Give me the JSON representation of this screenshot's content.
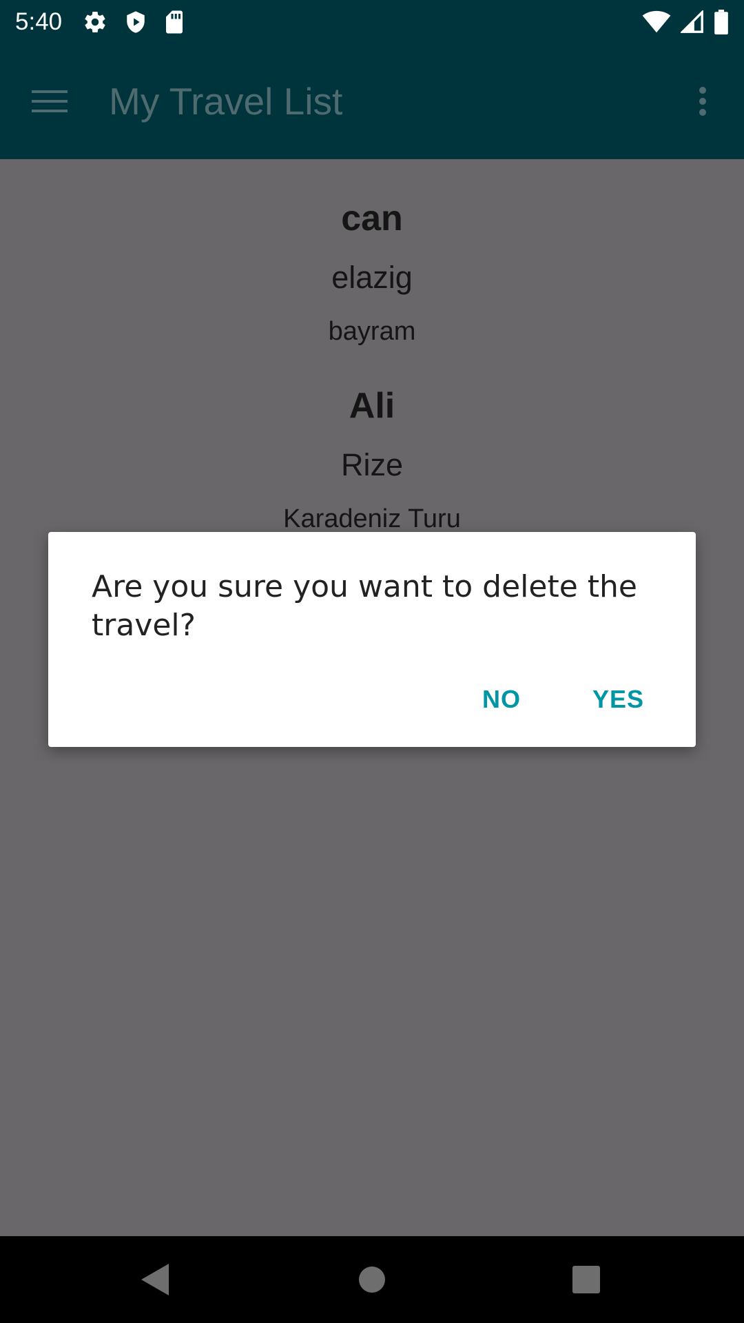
{
  "status_bar": {
    "time": "5:40",
    "left_icons": [
      "settings-icon",
      "shield-icon",
      "sd-card-icon"
    ],
    "right_icons": [
      "wifi-icon",
      "signal-icon",
      "battery-icon"
    ]
  },
  "app_bar": {
    "title": "My Travel List",
    "menu_icon": "hamburger-menu-icon",
    "overflow_icon": "overflow-menu-icon"
  },
  "travels": [
    {
      "title": "can",
      "place": "elazig",
      "description": "bayram"
    },
    {
      "title": "Ali",
      "place": "Rize",
      "description": "Karadeniz Turu"
    }
  ],
  "dialog": {
    "message": "Are you sure you want to delete the travel?",
    "no_label": "NO",
    "yes_label": "YES"
  },
  "nav_bar": {
    "icons": [
      "back-icon",
      "home-icon",
      "recents-icon"
    ]
  },
  "colors": {
    "app_bar": "#00343c",
    "scrim_background": "#696769",
    "dialog_button": "#0096a4"
  }
}
